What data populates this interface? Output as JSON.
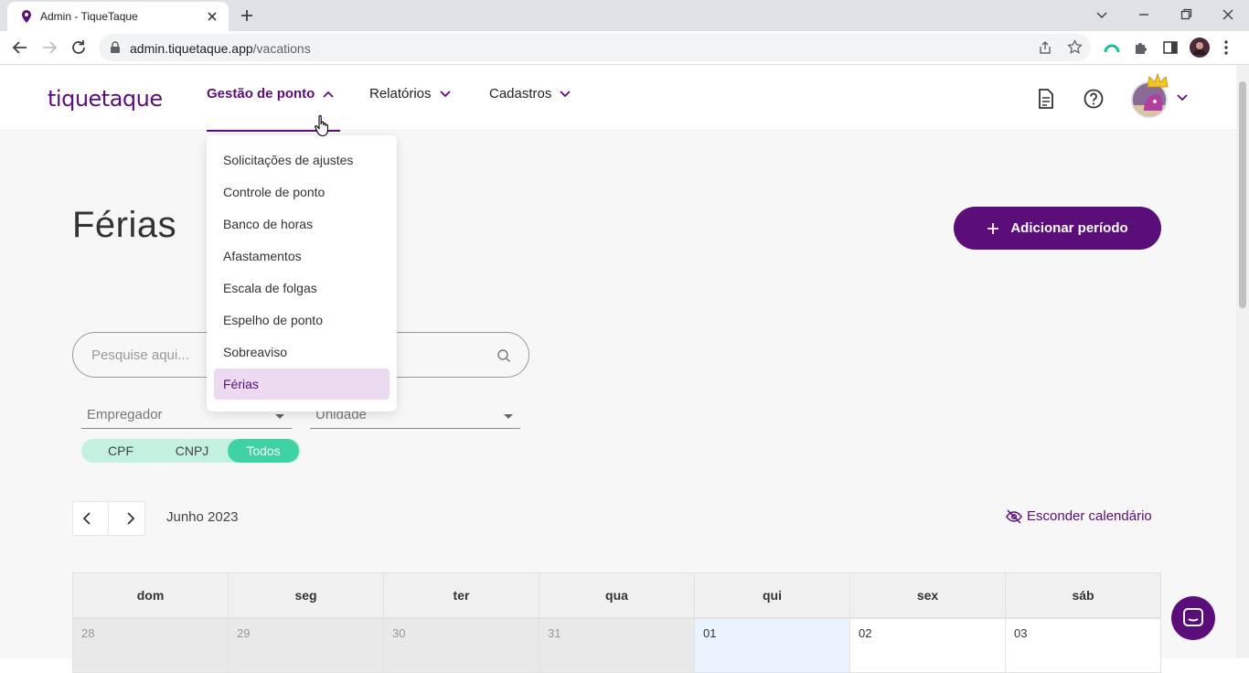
{
  "browser": {
    "tab_title": "Admin - TiqueTaque",
    "url_host": "admin.tiquetaque.app",
    "url_path": "/vacations"
  },
  "header": {
    "logo": "tiquetaque",
    "nav": [
      {
        "label": "Gestão de ponto"
      },
      {
        "label": "Relatórios"
      },
      {
        "label": "Cadastros"
      }
    ]
  },
  "menu": {
    "items": [
      {
        "label": "Solicitações de ajustes"
      },
      {
        "label": "Controle de ponto"
      },
      {
        "label": "Banco de horas"
      },
      {
        "label": "Afastamentos"
      },
      {
        "label": "Escala de folgas"
      },
      {
        "label": "Espelho de ponto"
      },
      {
        "label": "Sobreaviso"
      },
      {
        "label": "Férias"
      }
    ],
    "selected": "Férias"
  },
  "page": {
    "title": "Férias",
    "add_button": "Adicionar período",
    "search_placeholder": "Pesquise aqui...",
    "filters": {
      "employer_label": "Empregador",
      "unit_label": "Unidade"
    },
    "segment": {
      "options": [
        "CPF",
        "CNPJ",
        "Todos"
      ],
      "selected": "Todos"
    },
    "calendar": {
      "month_label": "Junho 2023",
      "hide_label": "Esconder calendário",
      "weekdays": [
        "dom",
        "seg",
        "ter",
        "qua",
        "qui",
        "sex",
        "sáb"
      ],
      "first_row": [
        "28",
        "29",
        "30",
        "31",
        "01",
        "02",
        "03"
      ]
    }
  },
  "colors": {
    "brand": "#5b0d7a",
    "accent_green": "#3fd2a4",
    "segment_bg": "#c4f0e0",
    "menu_selected_bg": "#ecdaf0"
  }
}
